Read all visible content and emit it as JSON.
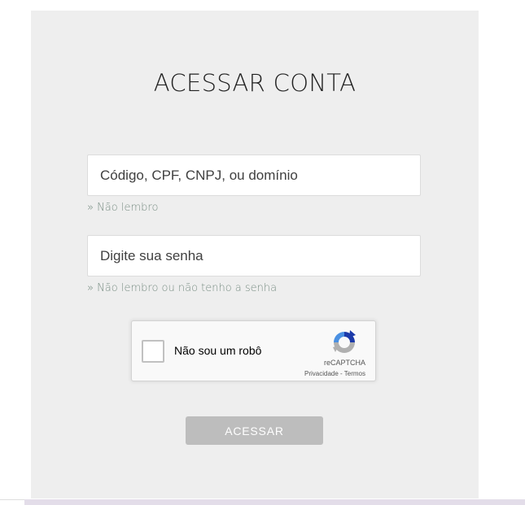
{
  "login": {
    "title": "ACESSAR CONTA",
    "user_field": {
      "placeholder": "Código, CPF, CNPJ, ou domínio",
      "value": ""
    },
    "user_help": "» Não lembro",
    "password_field": {
      "placeholder": "Digite sua senha",
      "value": ""
    },
    "password_help": "» Não lembro ou não tenho a senha",
    "submit_label": "ACESSAR"
  },
  "captcha": {
    "label": "Não sou um robô",
    "brand": "reCAPTCHA",
    "privacy": "Privacidade",
    "separator": " - ",
    "terms": "Termos",
    "checked": false
  },
  "colors": {
    "panel_bg": "#eeeeee",
    "link": "#7a8f85",
    "button_bg": "#bdbdbd",
    "recaptcha_blue": "#1c3aa9",
    "recaptcha_light_blue": "#4a90e2",
    "recaptcha_gray": "#b0b0b0"
  },
  "icons": [
    "recaptcha-logo-icon"
  ]
}
